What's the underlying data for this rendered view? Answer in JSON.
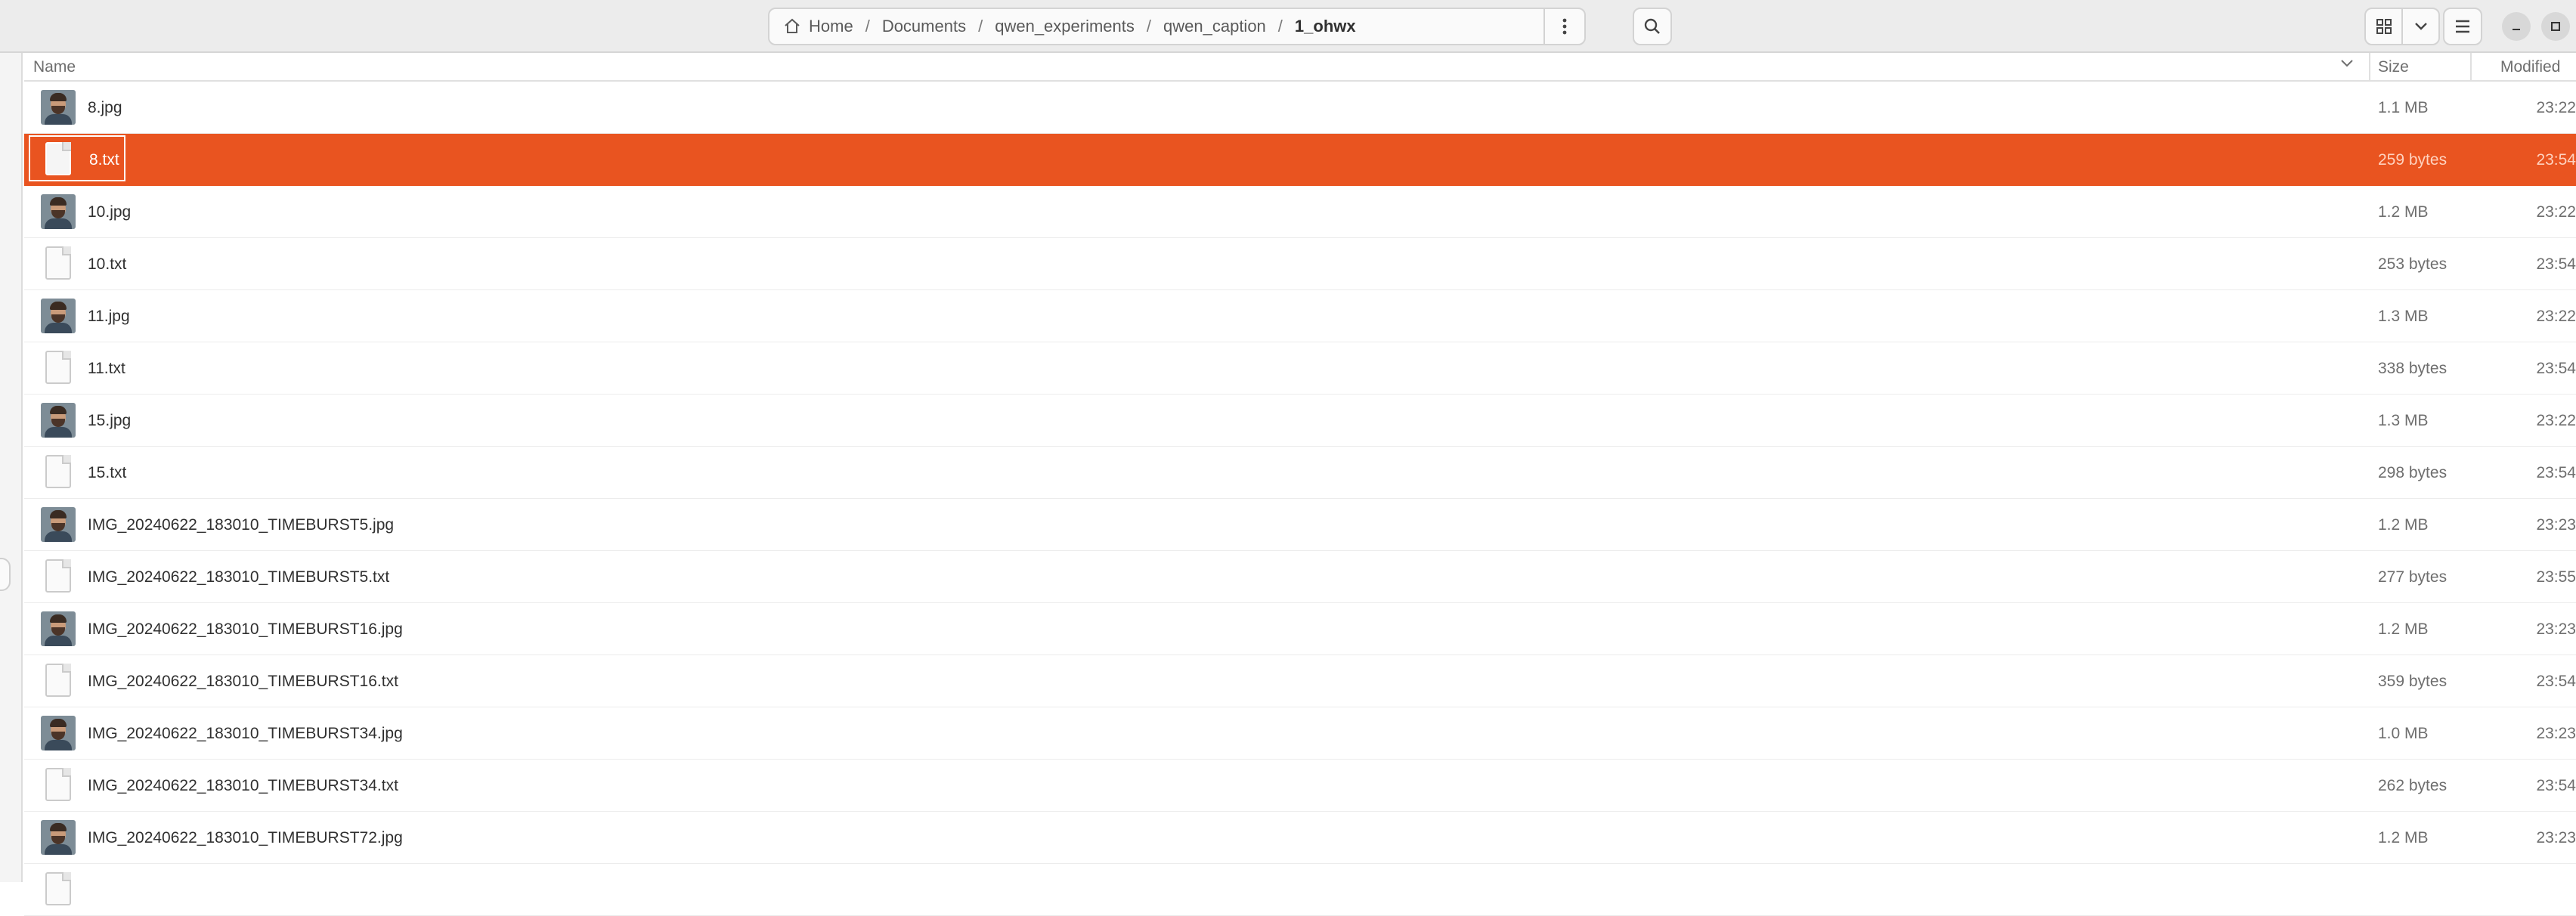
{
  "breadcrumb": {
    "items": [
      "Home",
      "Documents",
      "qwen_experiments",
      "qwen_caption",
      "1_ohwx"
    ]
  },
  "columns": {
    "name": "Name",
    "size": "Size",
    "modified": "Modified"
  },
  "colors": {
    "selection": "#e95420"
  },
  "files": [
    {
      "name": "8.jpg",
      "size": "1.1 MB",
      "modified": "23:22",
      "type": "image",
      "selected": false
    },
    {
      "name": "8.txt",
      "size": "259 bytes",
      "modified": "23:54",
      "type": "text",
      "selected": true
    },
    {
      "name": "10.jpg",
      "size": "1.2 MB",
      "modified": "23:22",
      "type": "image",
      "selected": false
    },
    {
      "name": "10.txt",
      "size": "253 bytes",
      "modified": "23:54",
      "type": "text",
      "selected": false
    },
    {
      "name": "11.jpg",
      "size": "1.3 MB",
      "modified": "23:22",
      "type": "image",
      "selected": false
    },
    {
      "name": "11.txt",
      "size": "338 bytes",
      "modified": "23:54",
      "type": "text",
      "selected": false
    },
    {
      "name": "15.jpg",
      "size": "1.3 MB",
      "modified": "23:22",
      "type": "image",
      "selected": false
    },
    {
      "name": "15.txt",
      "size": "298 bytes",
      "modified": "23:54",
      "type": "text",
      "selected": false
    },
    {
      "name": "IMG_20240622_183010_TIMEBURST5.jpg",
      "size": "1.2 MB",
      "modified": "23:23",
      "type": "image",
      "selected": false
    },
    {
      "name": "IMG_20240622_183010_TIMEBURST5.txt",
      "size": "277 bytes",
      "modified": "23:55",
      "type": "text",
      "selected": false
    },
    {
      "name": "IMG_20240622_183010_TIMEBURST16.jpg",
      "size": "1.2 MB",
      "modified": "23:23",
      "type": "image",
      "selected": false
    },
    {
      "name": "IMG_20240622_183010_TIMEBURST16.txt",
      "size": "359 bytes",
      "modified": "23:54",
      "type": "text",
      "selected": false
    },
    {
      "name": "IMG_20240622_183010_TIMEBURST34.jpg",
      "size": "1.0 MB",
      "modified": "23:23",
      "type": "image",
      "selected": false
    },
    {
      "name": "IMG_20240622_183010_TIMEBURST34.txt",
      "size": "262 bytes",
      "modified": "23:54",
      "type": "text",
      "selected": false
    },
    {
      "name": "IMG_20240622_183010_TIMEBURST72.jpg",
      "size": "1.2 MB",
      "modified": "23:23",
      "type": "image",
      "selected": false
    },
    {
      "name": "",
      "size": "",
      "modified": "",
      "type": "text",
      "selected": false
    }
  ]
}
